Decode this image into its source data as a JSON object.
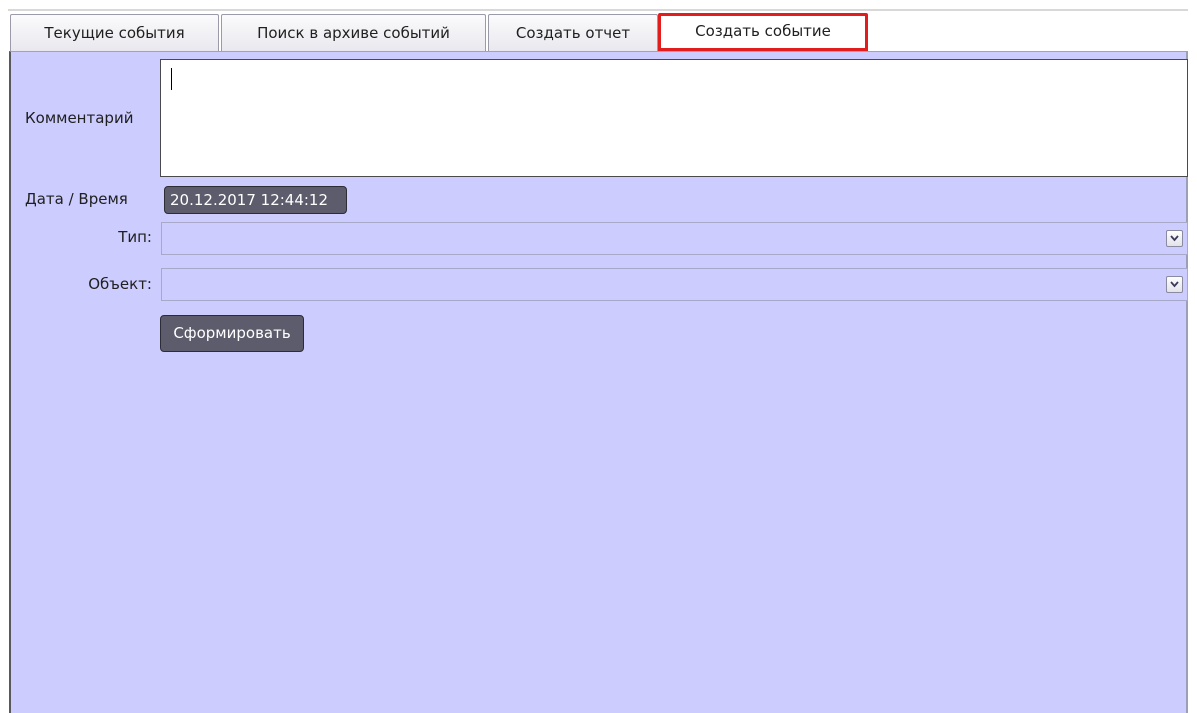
{
  "tabs": [
    {
      "label": "Текущие события"
    },
    {
      "label": "Поиск в архиве событий"
    },
    {
      "label": "Создать отчет"
    },
    {
      "label": "Создать событие"
    }
  ],
  "form": {
    "comment_label": "Комментарий",
    "comment_value": "",
    "datetime_label": "Дата / Время",
    "datetime_value": "20.12.2017 12:44:12",
    "type_label": "Тип:",
    "type_value": "",
    "object_label": "Объект:",
    "object_value": "",
    "submit_label": "Сформировать"
  },
  "icons": {
    "dropdown": "chevron-down-icon"
  },
  "colors": {
    "panel_background": "#ccccff",
    "active_tab_highlight": "#e11d1d",
    "button_background": "#5c5c6c"
  }
}
